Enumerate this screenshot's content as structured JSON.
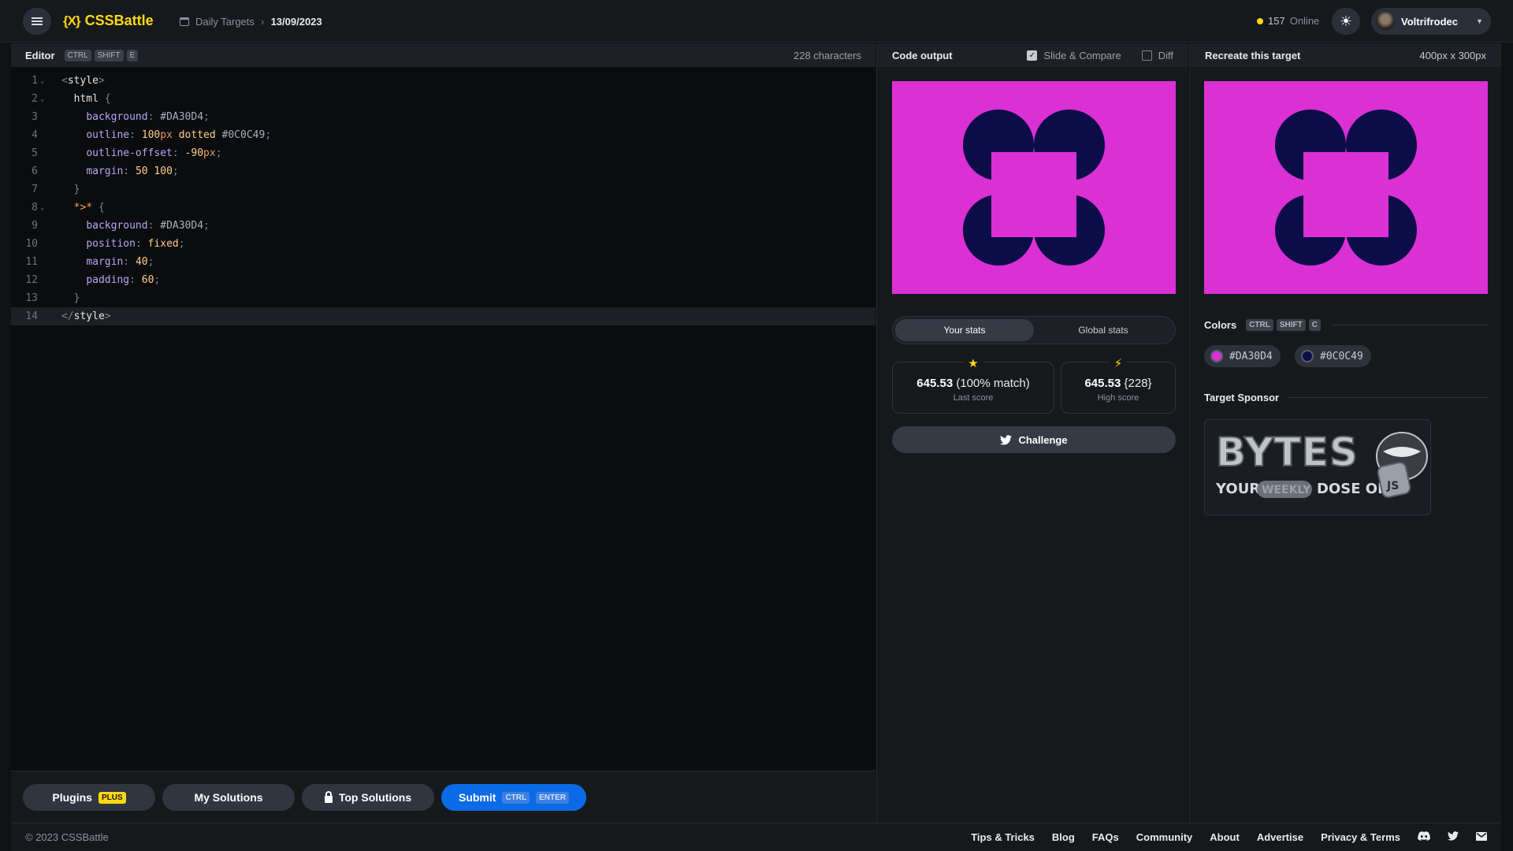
{
  "header": {
    "logo_mark": "{X}",
    "logo_text": "CSSBattle",
    "breadcrumb_section": "Daily Targets",
    "breadcrumb_date": "13/09/2023",
    "online_count": "157",
    "online_label": "Online",
    "username": "Voltrifrodec"
  },
  "editor": {
    "title": "Editor",
    "shortcut": [
      "CTRL",
      "SHIFT",
      "E"
    ],
    "char_count": "228 characters",
    "lines": [
      "<style>",
      "  html {",
      "    background: #DA30D4;",
      "    outline: 100px dotted #0C0C49;",
      "    outline-offset: -90px;",
      "    margin: 50 100;",
      "  }",
      "  *>* {",
      "    background: #DA30D4;",
      "    position: fixed;",
      "    margin: 40;",
      "    padding: 60;",
      "  }",
      "</style>"
    ],
    "active_line": 14
  },
  "bottom_bar": {
    "plugins": "Plugins",
    "plugins_badge": "PLUS",
    "my_solutions": "My Solutions",
    "top_solutions": "Top Solutions",
    "submit": "Submit",
    "submit_keys": [
      "CTRL",
      "ENTER"
    ]
  },
  "output": {
    "title": "Code output",
    "slide_compare": "Slide & Compare",
    "slide_compare_checked": true,
    "diff": "Diff",
    "diff_checked": false,
    "tab_your": "Your stats",
    "tab_global": "Global stats",
    "last_score": "645.53",
    "last_score_detail": "(100% match)",
    "last_score_label": "Last score",
    "high_score": "645.53",
    "high_score_detail": "{228}",
    "high_score_label": "High score",
    "challenge": "Challenge"
  },
  "target": {
    "title": "Recreate this target",
    "size": "400px x 300px",
    "colors_title": "Colors",
    "colors_shortcut": [
      "CTRL",
      "SHIFT",
      "C"
    ],
    "colors": [
      "#DA30D4",
      "#0C0C49"
    ],
    "sponsor_title": "Target Sponsor",
    "sponsor_line1": "BYTES",
    "sponsor_line2a": "YOUR",
    "sponsor_line2b": "WEEKLY",
    "sponsor_line2c": "DOSE OF",
    "sponsor_js": "JS"
  },
  "footer": {
    "copyright": "© 2023 CSSBattle",
    "links": [
      "Tips & Tricks",
      "Blog",
      "FAQs",
      "Community",
      "About",
      "Advertise",
      "Privacy & Terms"
    ]
  },
  "colors": {
    "pink": "#DA30D4",
    "navy": "#0C0C49",
    "accent": "#ffd814",
    "submit_blue": "#0b6be6"
  },
  "icons": [
    "menu-icon",
    "calendar-icon",
    "chevron-right-icon",
    "sun-icon",
    "chevron-down-icon",
    "checkbox-icon",
    "star-icon",
    "bolt-icon",
    "twitter-icon",
    "lock-icon",
    "discord-icon",
    "mail-icon"
  ]
}
